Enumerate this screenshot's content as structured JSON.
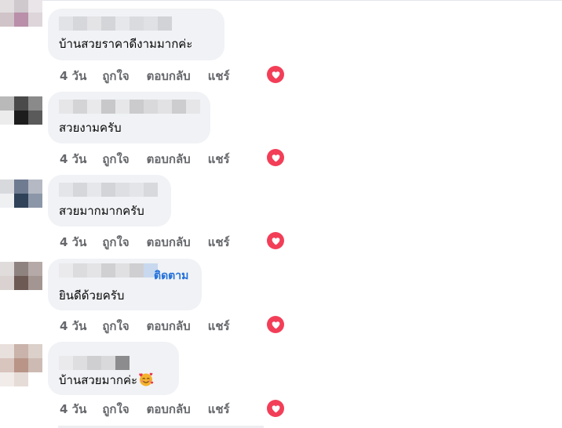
{
  "comments": [
    {
      "text": "บ้านสวยราคาดีงามมากค่ะ",
      "time": "4 วัน",
      "like_label": "ถูกใจ",
      "reply_label": "ตอบกลับ",
      "share_label": "แชร์",
      "reaction_icon": "heart-icon"
    },
    {
      "text": "สวยงามครับ",
      "time": "4 วัน",
      "like_label": "ถูกใจ",
      "reply_label": "ตอบกลับ",
      "share_label": "แชร์",
      "reaction_icon": "heart-icon"
    },
    {
      "text": "สวยมากมากครับ",
      "time": "4 วัน",
      "like_label": "ถูกใจ",
      "reply_label": "ตอบกลับ",
      "share_label": "แชร์",
      "reaction_icon": "heart-icon"
    },
    {
      "follow_label": "ติดตาม",
      "text": "ยินดีด้วยครับ",
      "time": "4 วัน",
      "like_label": "ถูกใจ",
      "reply_label": "ตอบกลับ",
      "share_label": "แชร์",
      "reaction_icon": "heart-icon"
    },
    {
      "text": "บ้านสวยมากค่ะ",
      "time": "4 วัน",
      "like_label": "ถูกใจ",
      "reply_label": "ตอบกลับ",
      "share_label": "แชร์",
      "reaction_icon": "heart-icon",
      "emoji": "smiling-face-with-hearts-icon"
    }
  ],
  "colors": {
    "bubble": "#f0f2f5",
    "meta_text": "#65676b",
    "link": "#216fdb",
    "heart": "#f33e58"
  }
}
